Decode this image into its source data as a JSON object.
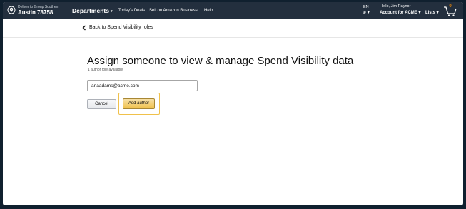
{
  "header": {
    "deliver_to_line": "Deliver to Group Southern",
    "deliver_to_location": "Austin 78758",
    "departments_label": "Departments",
    "nav_links": [
      "Today's Deals",
      "Sell on Amazon Business",
      "Help"
    ],
    "language": "EN",
    "greeting": "Hello, Jim Raynor",
    "account_label": "Account for ACME",
    "lists_label": "Lists",
    "cart_count": "0"
  },
  "back": {
    "label": "Back to Spend Visibility roles"
  },
  "main": {
    "title": "Assign someone to view & manage Spend Visibility data",
    "subtitle": "1 author role available",
    "email_value": "anaadams@acme.com",
    "cancel_label": "Cancel",
    "add_author_label": "Add author"
  },
  "colors": {
    "header_bg": "#232f3e",
    "primary_button": "#f0c14b",
    "highlight_border": "#f0c14b"
  },
  "icons": [
    "location-pin-icon",
    "chevron-down-icon",
    "globe-icon",
    "cart-icon",
    "chevron-left-icon"
  ]
}
